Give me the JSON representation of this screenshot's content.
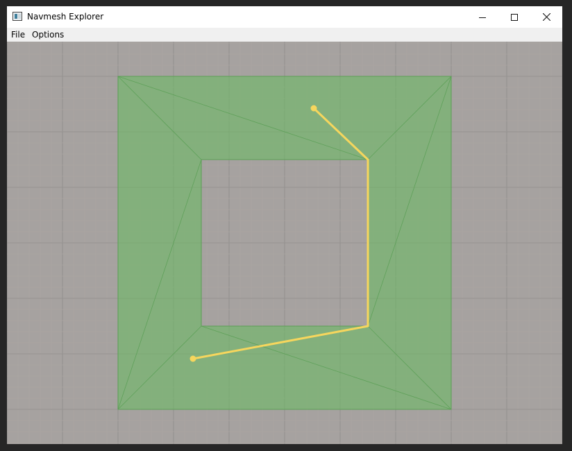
{
  "window": {
    "title": "Navmesh Explorer",
    "controls": {
      "minimize": "—",
      "maximize": "☐",
      "close": "✕"
    }
  },
  "menu": {
    "items": [
      {
        "label": "File"
      },
      {
        "label": "Options"
      }
    ]
  },
  "colors": {
    "background": "#a6a2a0",
    "grid_minor": "#aaa5a2",
    "grid_major": "#959290",
    "navmesh_fill": "#88b580",
    "navmesh_edge": "#5fa05a",
    "path": "#f5d55e"
  }
}
